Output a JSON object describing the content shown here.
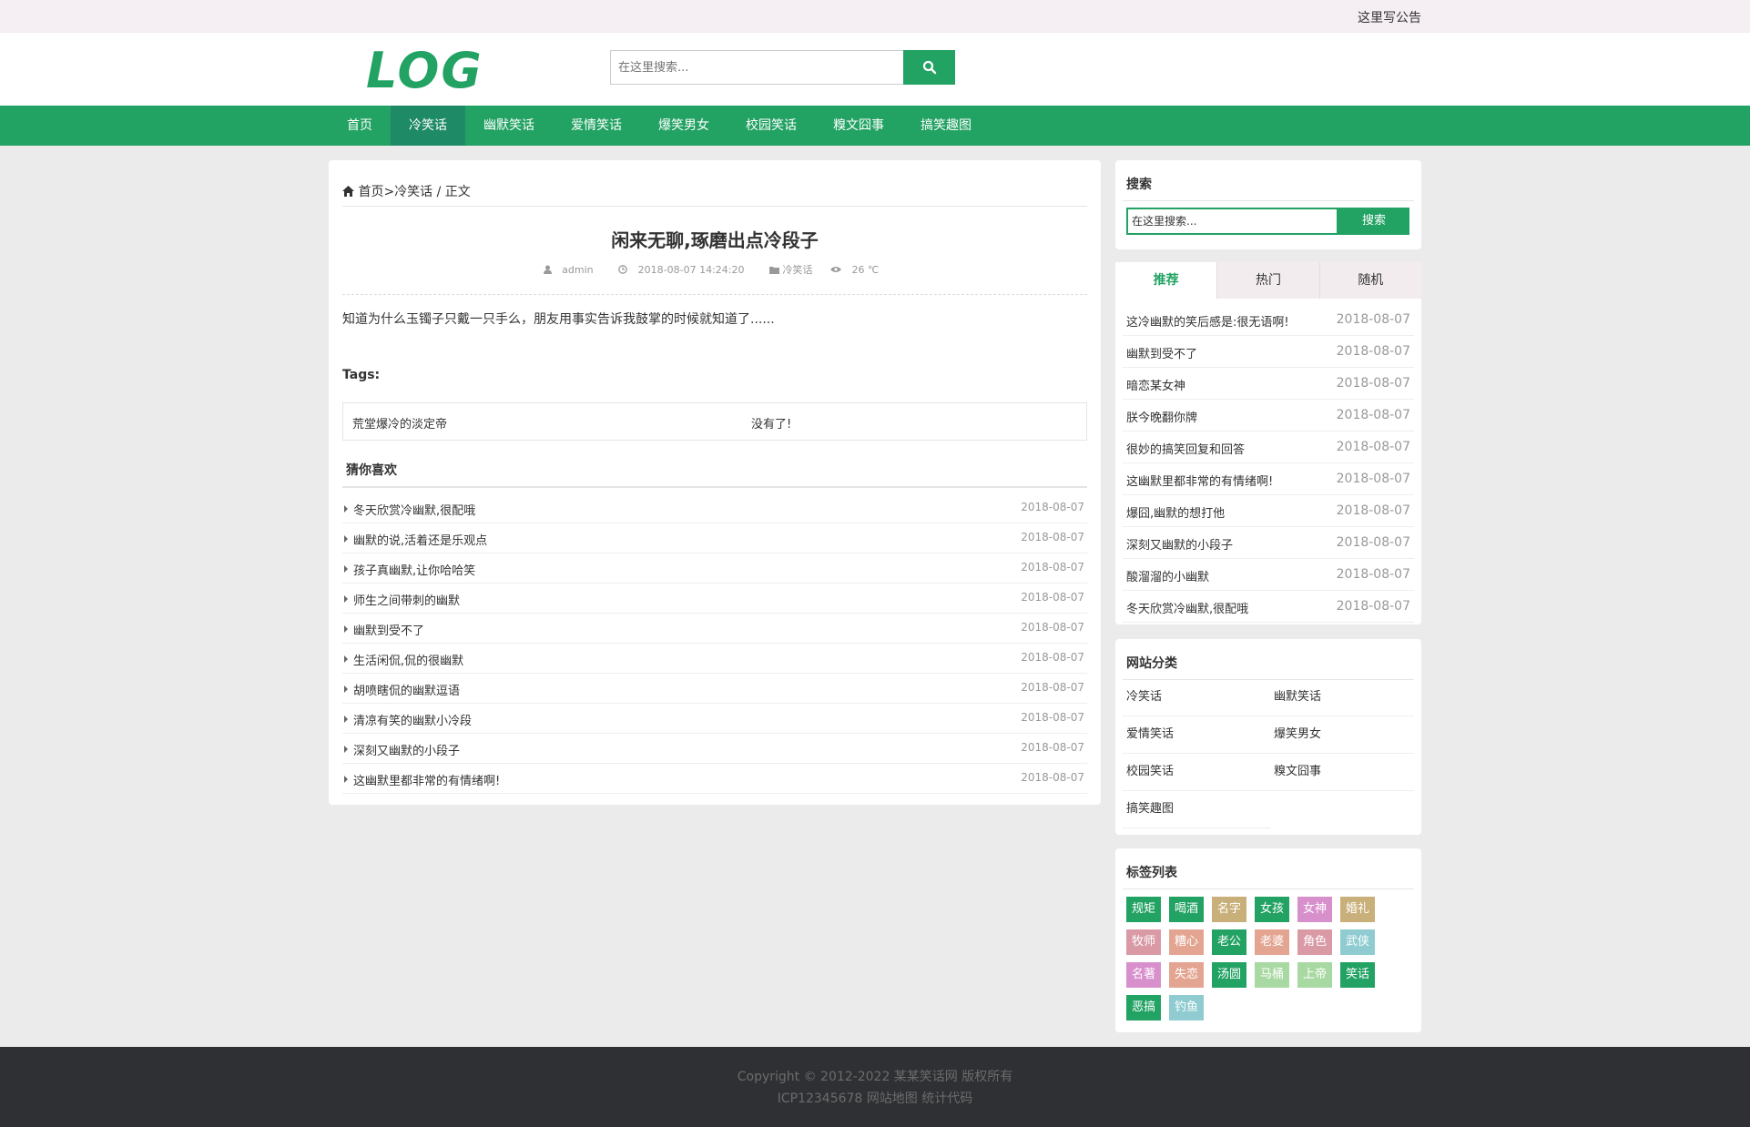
{
  "topbar": {
    "notice": "这里写公告"
  },
  "header": {
    "logo_text": "LOGO",
    "search_placeholder": "在这里搜索..."
  },
  "nav": {
    "items": [
      "首页",
      "冷笑话",
      "幽默笑话",
      "爱情笑话",
      "爆笑男女",
      "校园笑话",
      "糗文囧事",
      "搞笑趣图"
    ],
    "active": "冷笑话"
  },
  "breadcrumb": {
    "home": "首页",
    "sep": ">",
    "category": "冷笑话",
    "tail": " / 正文"
  },
  "article": {
    "title": "闲来无聊,琢磨出点冷段子",
    "author": "admin",
    "datetime": "2018-08-07 14:24:20",
    "category": "冷笑话",
    "views": "26 ℃",
    "body": "知道为什么玉镯子只戴一只手么，朋友用事实告诉我鼓掌的时候就知道了......",
    "tags_label": "Tags:",
    "prev": "荒堂爆冷的淡定帝",
    "next": "没有了!"
  },
  "guess": {
    "title": "猜你喜欢",
    "items": [
      {
        "title": "冬天欣赏冷幽默,很配哦",
        "date": "2018-08-07"
      },
      {
        "title": "幽默的说,活着还是乐观点",
        "date": "2018-08-07"
      },
      {
        "title": "孩子真幽默,让你哈哈笑",
        "date": "2018-08-07"
      },
      {
        "title": "师生之间带刺的幽默",
        "date": "2018-08-07"
      },
      {
        "title": "幽默到受不了",
        "date": "2018-08-07"
      },
      {
        "title": "生活闲侃,侃的很幽默",
        "date": "2018-08-07"
      },
      {
        "title": "胡喷瞎侃的幽默逗语",
        "date": "2018-08-07"
      },
      {
        "title": "清凉有笑的幽默小冷段",
        "date": "2018-08-07"
      },
      {
        "title": "深刻又幽默的小段子",
        "date": "2018-08-07"
      },
      {
        "title": "这幽默里都非常的有情绪啊!",
        "date": "2018-08-07"
      }
    ]
  },
  "sidebar": {
    "search": {
      "title": "搜索",
      "placeholder": "在这里搜索...",
      "button": "搜索"
    },
    "tabs": {
      "labels": [
        "推荐",
        "热门",
        "随机"
      ],
      "active": "推荐",
      "items": [
        {
          "title": "这冷幽默的笑后感是:很无语啊!",
          "date": "2018-08-07"
        },
        {
          "title": "幽默到受不了",
          "date": "2018-08-07"
        },
        {
          "title": "暗恋某女神",
          "date": "2018-08-07"
        },
        {
          "title": "朕今晚翻你牌",
          "date": "2018-08-07"
        },
        {
          "title": "很妙的搞笑回复和回答",
          "date": "2018-08-07"
        },
        {
          "title": "这幽默里都非常的有情绪啊!",
          "date": "2018-08-07"
        },
        {
          "title": "爆囧,幽默的想打他",
          "date": "2018-08-07"
        },
        {
          "title": "深刻又幽默的小段子",
          "date": "2018-08-07"
        },
        {
          "title": "酸溜溜的小幽默",
          "date": "2018-08-07"
        },
        {
          "title": "冬天欣赏冷幽默,很配哦",
          "date": "2018-08-07"
        }
      ]
    },
    "categories": {
      "title": "网站分类",
      "items": [
        "冷笑话",
        "幽默笑话",
        "爱情笑话",
        "爆笑男女",
        "校园笑话",
        "糗文囧事",
        "搞笑趣图"
      ]
    },
    "tags": {
      "title": "标签列表",
      "items": [
        {
          "label": "规矩",
          "color": "#22a263"
        },
        {
          "label": "喝酒",
          "color": "#22a263"
        },
        {
          "label": "名字",
          "color": "#c9b07a"
        },
        {
          "label": "女孩",
          "color": "#22a263"
        },
        {
          "label": "女神",
          "color": "#d890cc"
        },
        {
          "label": "婚礼",
          "color": "#c9b07a"
        },
        {
          "label": "牧师",
          "color": "#d99aa6"
        },
        {
          "label": "糟心",
          "color": "#e3a592"
        },
        {
          "label": "老公",
          "color": "#22a263"
        },
        {
          "label": "老婆",
          "color": "#e3a592"
        },
        {
          "label": "角色",
          "color": "#d99aa6"
        },
        {
          "label": "武侠",
          "color": "#8fcbd0"
        },
        {
          "label": "名著",
          "color": "#d890cc"
        },
        {
          "label": "失恋",
          "color": "#e3a592"
        },
        {
          "label": "汤圆",
          "color": "#22a263"
        },
        {
          "label": "马桶",
          "color": "#a9d9a3"
        },
        {
          "label": "上帝",
          "color": "#a9d9a3"
        },
        {
          "label": "笑话",
          "color": "#22a263"
        },
        {
          "label": "恶搞",
          "color": "#22a263"
        },
        {
          "label": "钓鱼",
          "color": "#8fcbd0"
        }
      ]
    }
  },
  "footer": {
    "copyright": "Copyright © 2012-2022 某某笑话网 版权所有",
    "icp": "ICP12345678 网站地图 统计代码"
  },
  "colors": {
    "brand": "#22a263",
    "nav_active": "#1e8a66",
    "footer_bg": "#2e3033"
  }
}
